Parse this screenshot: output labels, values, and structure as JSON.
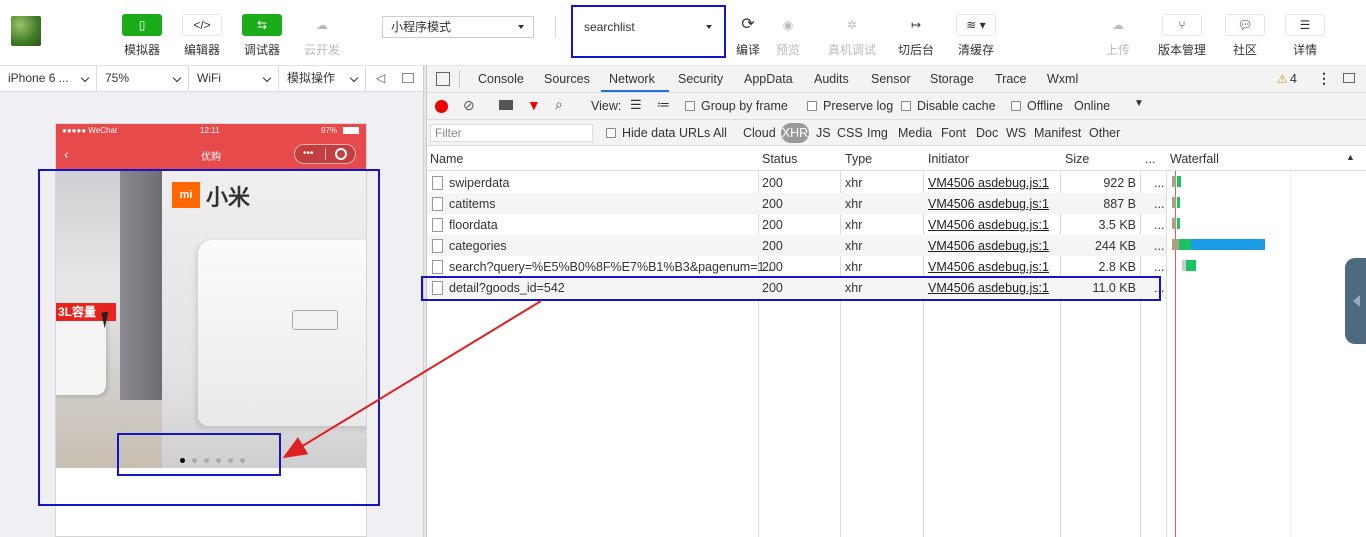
{
  "toolbar": {
    "simulator": "模拟器",
    "editor": "编辑器",
    "debugger": "调试器",
    "cloud": "云开发",
    "mode": "小程序模式",
    "compile_target": "searchlist",
    "compile": "编译",
    "preview": "预览",
    "remote_debug": "真机调试",
    "background": "切后台",
    "clear_cache": "清缓存",
    "upload": "上传",
    "version": "版本管理",
    "community": "社区",
    "details": "详情"
  },
  "device_bar": {
    "device": "iPhone 6 ...",
    "zoom": "75%",
    "network": "WiFi",
    "simulate": "模拟操作"
  },
  "phone": {
    "carrier": "●●●●● WeChat",
    "time": "12:11",
    "battery": "97%",
    "title": "优购",
    "capsule_more": "•••",
    "banner_caption": "3L容量",
    "brand_logo": "mi",
    "brand_name": "小米",
    "dots": 6
  },
  "devtools": {
    "tabs": [
      "Console",
      "Sources",
      "Network",
      "Security",
      "AppData",
      "Audits",
      "Sensor",
      "Storage",
      "Trace",
      "Wxml"
    ],
    "active_tab": "Network",
    "warnings": "4",
    "view_label": "View:",
    "group_by_frame": "Group by frame",
    "preserve_log": "Preserve log",
    "disable_cache": "Disable cache",
    "offline": "Offline",
    "online": "Online",
    "filter_placeholder": "Filter",
    "hide_data_urls": "Hide data URLs",
    "filter_types": [
      "All",
      "Cloud",
      "XHR",
      "JS",
      "CSS",
      "Img",
      "Media",
      "Font",
      "Doc",
      "WS",
      "Manifest",
      "Other"
    ],
    "active_filter": "XHR",
    "columns": {
      "name": "Name",
      "status": "Status",
      "type": "Type",
      "initiator": "Initiator",
      "size": "Size",
      "more": "...",
      "waterfall": "Waterfall"
    },
    "requests": [
      {
        "name": "swiperdata",
        "status": "200",
        "type": "xhr",
        "initiator": "VM4506 asdebug.js:1",
        "size": "922 B",
        "more": "..."
      },
      {
        "name": "catitems",
        "status": "200",
        "type": "xhr",
        "initiator": "VM4506 asdebug.js:1",
        "size": "887 B",
        "more": "..."
      },
      {
        "name": "floordata",
        "status": "200",
        "type": "xhr",
        "initiator": "VM4506 asdebug.js:1",
        "size": "3.5 KB",
        "more": "..."
      },
      {
        "name": "categories",
        "status": "200",
        "type": "xhr",
        "initiator": "VM4506 asdebug.js:1",
        "size": "244 KB",
        "more": "..."
      },
      {
        "name": "search?query=%E5%B0%8F%E7%B1%B3&pagenum=1...",
        "status": "200",
        "type": "xhr",
        "initiator": "VM4506 asdebug.js:1",
        "size": "2.8 KB",
        "more": "..."
      },
      {
        "name": "detail?goods_id=542",
        "status": "200",
        "type": "xhr",
        "initiator": "VM4506 asdebug.js:1",
        "size": "11.0 KB",
        "more": "..."
      }
    ]
  },
  "colors": {
    "accent_green": "#1aad19",
    "phone_red": "#e64a4a",
    "highlight": "#1414c8",
    "arrow": "#e02020",
    "waterfall_blue": "#1a9be6",
    "waterfall_green": "#19c464"
  }
}
